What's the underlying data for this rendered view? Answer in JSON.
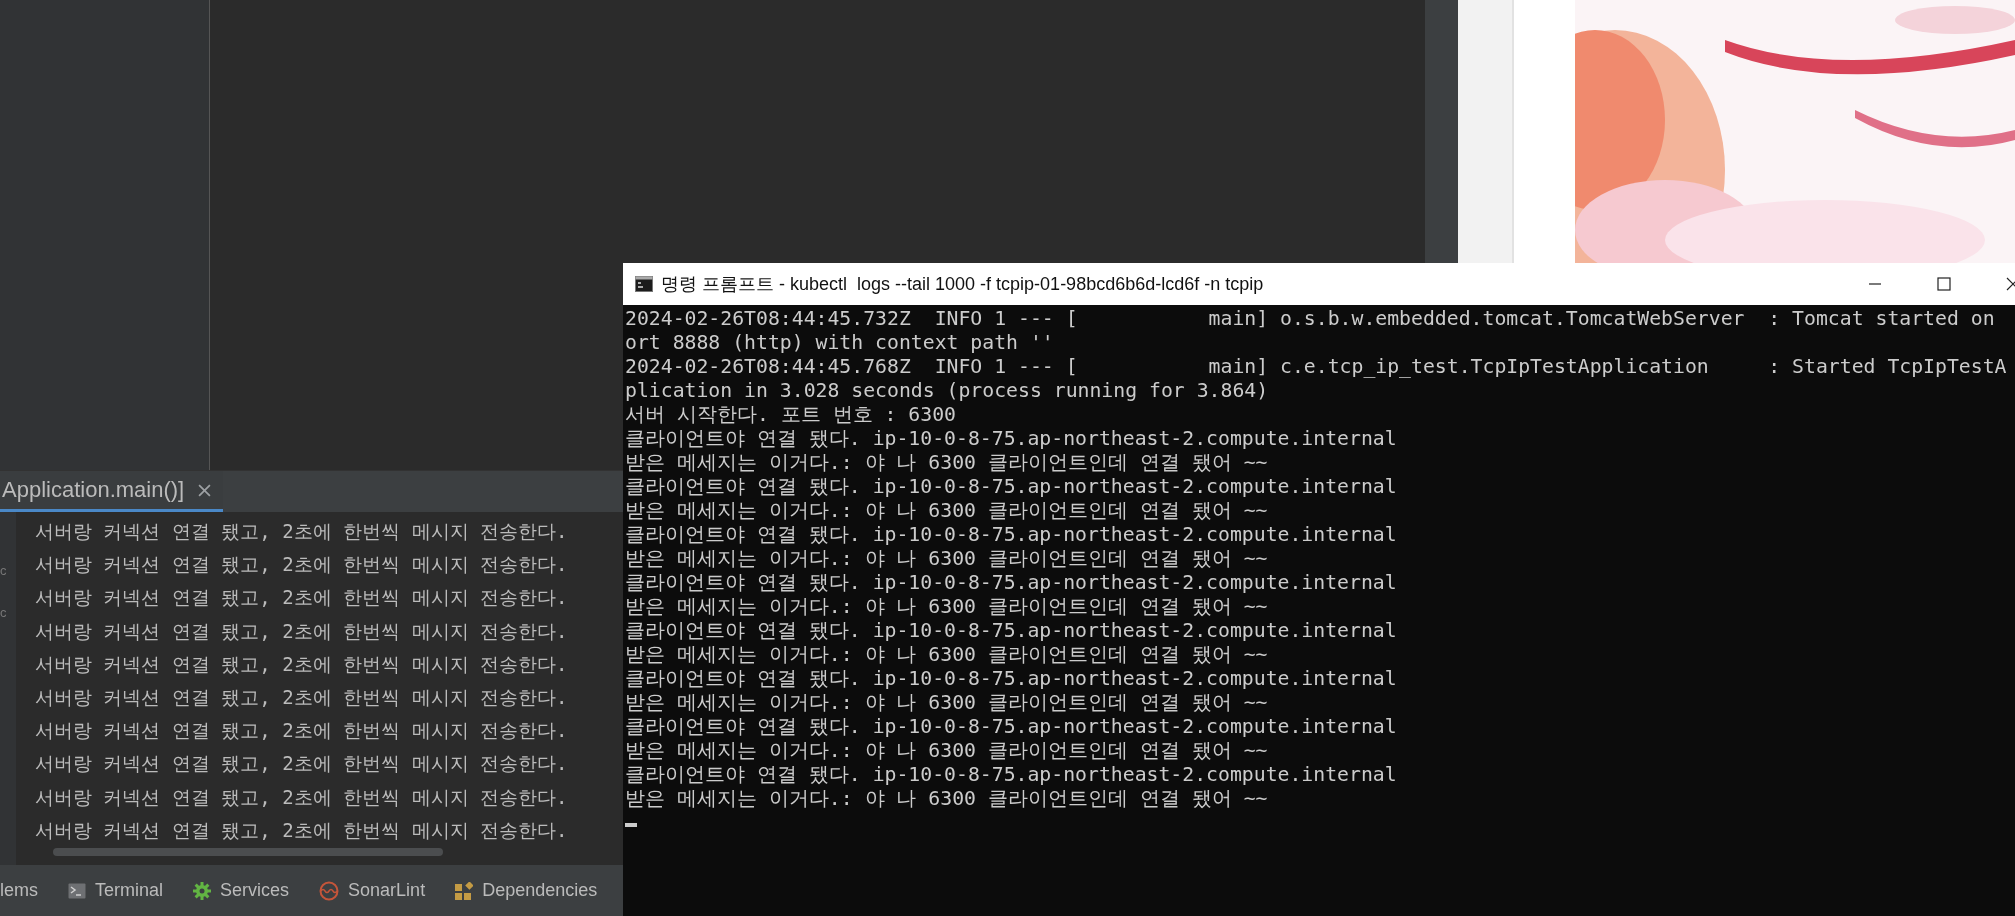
{
  "ide": {
    "gutter_marks": [
      "c",
      "c"
    ],
    "console_tab": {
      "label": "Application.main()]",
      "selected": true
    },
    "console_lines": [
      "서버랑 커넥션 연결 됐고, 2초에 한번씩 메시지 전송한다.",
      "서버랑 커넥션 연결 됐고, 2초에 한번씩 메시지 전송한다.",
      "서버랑 커넥션 연결 됐고, 2초에 한번씩 메시지 전송한다.",
      "서버랑 커넥션 연결 됐고, 2초에 한번씩 메시지 전송한다.",
      "서버랑 커넥션 연결 됐고, 2초에 한번씩 메시지 전송한다.",
      "서버랑 커넥션 연결 됐고, 2초에 한번씩 메시지 전송한다.",
      "서버랑 커넥션 연결 됐고, 2초에 한번씩 메시지 전송한다.",
      "서버랑 커넥션 연결 됐고, 2초에 한번씩 메시지 전송한다.",
      "서버랑 커넥션 연결 됐고, 2초에 한번씩 메시지 전송한다.",
      "서버랑 커넥션 연결 됐고, 2초에 한번씩 메시지 전송한다."
    ],
    "tool_windows": [
      {
        "label": "lems",
        "kind": "plain"
      },
      {
        "label": "Terminal",
        "kind": "terminal"
      },
      {
        "label": "Services",
        "kind": "services"
      },
      {
        "label": "SonarLint",
        "kind": "sonarlint"
      },
      {
        "label": "Dependencies",
        "kind": "dependencies"
      }
    ]
  },
  "console_window": {
    "title": "명령 프롬프트 - kubectl  logs --tail 1000 -f tcpip-01-98bcd6b6d-lcd6f -n tcpip",
    "lines": [
      "2024-02-26T08:44:45.732Z  INFO 1 --- [           main] o.s.b.w.embedded.tomcat.TomcatWebServer  : Tomcat started on",
      "ort 8888 (http) with context path ''",
      "2024-02-26T08:44:45.768Z  INFO 1 --- [           main] c.e.tcp_ip_test.TcpIpTestApplication     : Started TcpIpTestA",
      "plication in 3.028 seconds (process running for 3.864)",
      "서버 시작한다. 포트 번호 : 6300",
      "클라이언트야 연결 됐다. ip-10-0-8-75.ap-northeast-2.compute.internal",
      "받은 메세지는 이거다.: 야 나 6300 클라이언트인데 연결 됐어 ~~",
      "클라이언트야 연결 됐다. ip-10-0-8-75.ap-northeast-2.compute.internal",
      "받은 메세지는 이거다.: 야 나 6300 클라이언트인데 연결 됐어 ~~",
      "클라이언트야 연결 됐다. ip-10-0-8-75.ap-northeast-2.compute.internal",
      "받은 메세지는 이거다.: 야 나 6300 클라이언트인데 연결 됐어 ~~",
      "클라이언트야 연결 됐다. ip-10-0-8-75.ap-northeast-2.compute.internal",
      "받은 메세지는 이거다.: 야 나 6300 클라이언트인데 연결 됐어 ~~",
      "클라이언트야 연결 됐다. ip-10-0-8-75.ap-northeast-2.compute.internal",
      "받은 메세지는 이거다.: 야 나 6300 클라이언트인데 연결 됐어 ~~",
      "클라이언트야 연결 됐다. ip-10-0-8-75.ap-northeast-2.compute.internal",
      "받은 메세지는 이거다.: 야 나 6300 클라이언트인데 연결 됐어 ~~",
      "클라이언트야 연결 됐다. ip-10-0-8-75.ap-northeast-2.compute.internal",
      "받은 메세지는 이거다.: 야 나 6300 클라이언트인데 연결 됐어 ~~",
      "클라이언트야 연결 됐다. ip-10-0-8-75.ap-northeast-2.compute.internal",
      "받은 메세지는 이거다.: 야 나 6300 클라이언트인데 연결 됐어 ~~"
    ]
  }
}
